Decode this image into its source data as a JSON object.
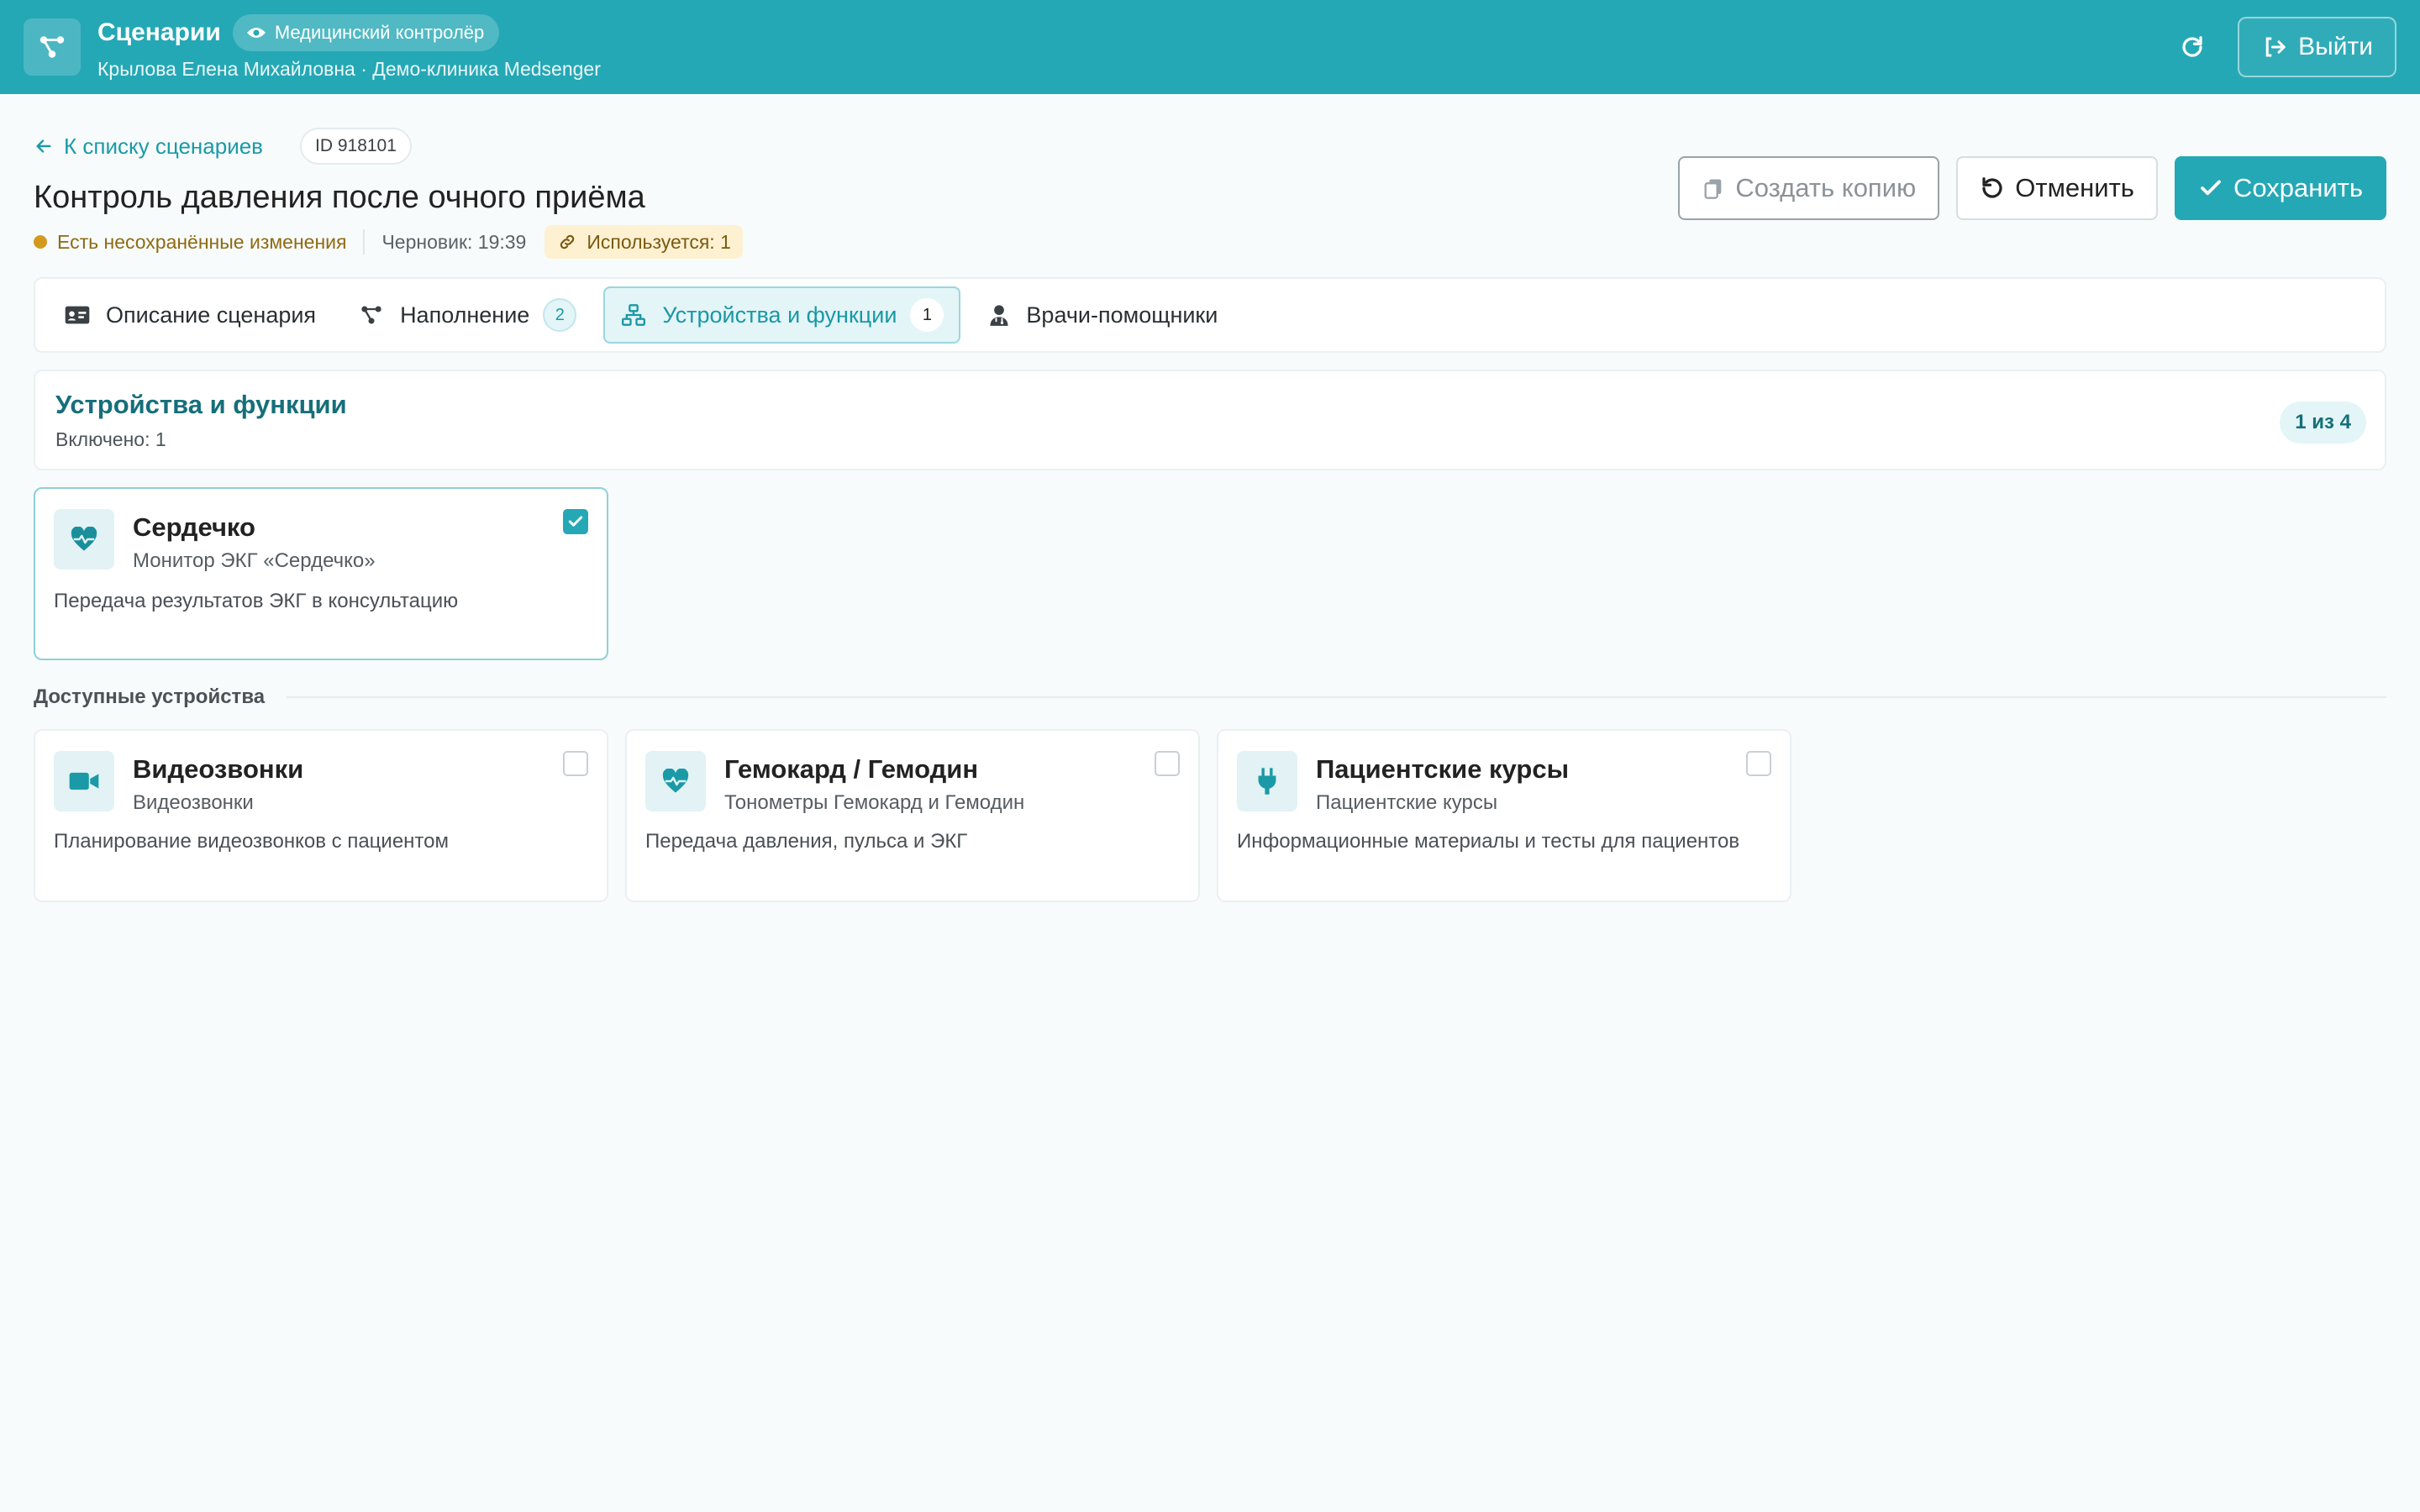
{
  "header": {
    "app_title": "Сценарии",
    "role_badge": "Медицинский контролёр",
    "user_line": "Крылова Елена Михайловна · Демо-клиника Medsenger",
    "logout_label": "Выйти",
    "accent_color": "#25a8b5"
  },
  "scenario": {
    "back_label": "К списку сценариев",
    "id_label": "ID 918101",
    "title": "Контроль давления после очного приёма",
    "unsaved_label": "Есть несохранённые изменения",
    "draft_label": "Черновик: 19:39",
    "used_label": "Используется: 1"
  },
  "actions": {
    "copy_label": "Создать копию",
    "cancel_label": "Отменить",
    "save_label": "Сохранить"
  },
  "tabs": [
    {
      "label": "Описание сценария",
      "count": null,
      "icon": "id-card-icon",
      "active": false
    },
    {
      "label": "Наполнение",
      "count": "2",
      "icon": "nodes-icon",
      "active": false
    },
    {
      "label": "Устройства и функции",
      "count": "1",
      "icon": "network-icon",
      "active": true
    },
    {
      "label": "Врачи-помощники",
      "count": null,
      "icon": "doctor-icon",
      "active": false
    }
  ],
  "section": {
    "title": "Устройства и функции",
    "enabled_label": "Включено: 1",
    "pager": "1 из 4"
  },
  "selected_devices": [
    {
      "name": "Сердечко",
      "subtitle": "Монитор ЭКГ «Сердечко»",
      "description": "Передача результатов ЭКГ в консультацию",
      "icon": "heart-pulse-icon",
      "checked": true
    }
  ],
  "available_label": "Доступные устройства",
  "available_devices": [
    {
      "name": "Видеозвонки",
      "subtitle": "Видеозвонки",
      "description": "Планирование видеозвонков с пациентом",
      "icon": "video-icon",
      "checked": false
    },
    {
      "name": "Гемокард / Гемодин",
      "subtitle": "Тонометры Гемокард и Гемодин",
      "description": "Передача давления, пульса и ЭКГ",
      "icon": "heart-pulse-icon",
      "checked": false
    },
    {
      "name": "Пациентские курсы",
      "subtitle": "Пациентские курсы",
      "description": "Информационные материалы и тесты для пациентов",
      "icon": "plug-icon",
      "checked": false
    }
  ]
}
